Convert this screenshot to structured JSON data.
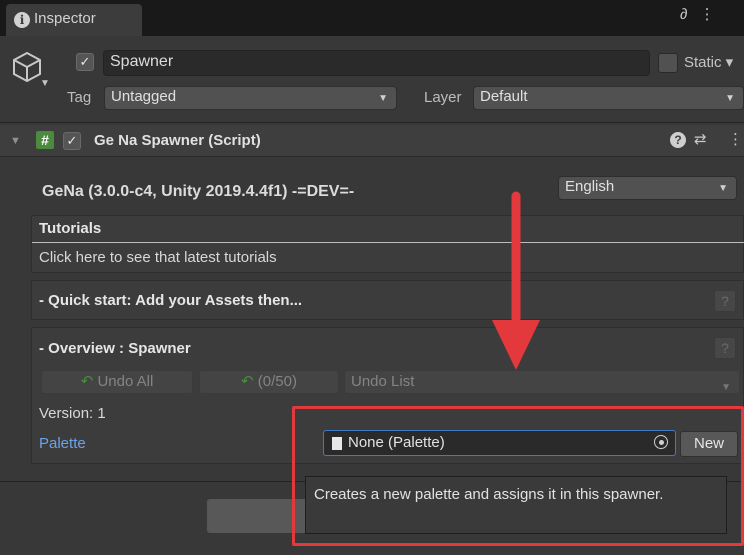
{
  "window": {
    "tab_label": "Inspector",
    "tab_icons": "∂ ⋮"
  },
  "gameobject": {
    "active": true,
    "name": "Spawner",
    "static_label": "Static",
    "tag_label": "Tag",
    "tag_value": "Untagged",
    "layer_label": "Layer",
    "layer_value": "Default"
  },
  "component": {
    "enabled": true,
    "title": "Ge Na Spawner (Script)",
    "version_header": "GeNa (3.0.0-c4, Unity 2019.4.4f1) -=DEV=-",
    "language": "English",
    "tutorials": {
      "title": "Tutorials",
      "link": "Click here to see that latest tutorials"
    },
    "quick_start": {
      "title": "- Quick start: Add your Assets then...",
      "help": "?"
    },
    "overview": {
      "title": "- Overview : Spawner",
      "help": "?",
      "undo_all": "Undo All",
      "undo_count": "(0/50)",
      "undo_list": "Undo List",
      "version": "Version: 1",
      "palette_label": "Palette",
      "palette_value": "None (Palette)",
      "new_button": "New"
    },
    "tooltip": "Creates a new palette and assigns it in this spawner."
  },
  "colors": {
    "annotation_red": "#e3383c",
    "accent_blue": "#3d7bc4",
    "script_green": "#4c8a3d"
  },
  "icons": [
    "info-icon",
    "lock-icon",
    "menu-icon",
    "cube-icon",
    "check-icon",
    "script-icon",
    "help-icon",
    "preset-icon",
    "undo-icon",
    "document-icon",
    "object-picker-icon",
    "red-arrow-annotation"
  ]
}
